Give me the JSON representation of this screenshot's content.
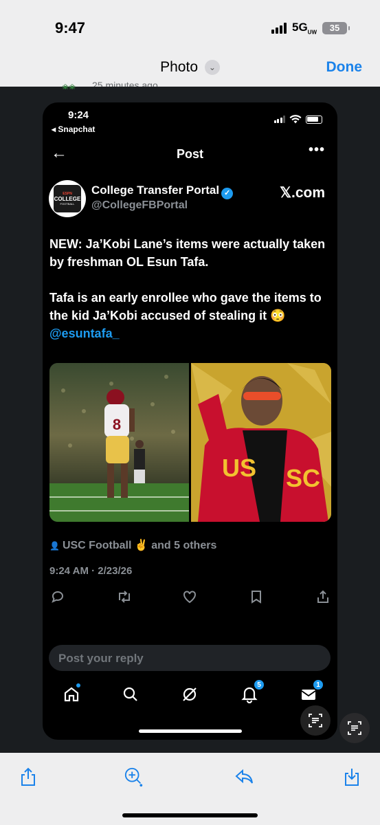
{
  "outer_status": {
    "time": "9:47",
    "network": "5G",
    "network_sub": "UW",
    "battery": "35"
  },
  "outer_nav": {
    "title": "Photo",
    "done_label": "Done"
  },
  "peek": {
    "text": "25 minutes ago"
  },
  "inner_status": {
    "time": "9:24",
    "back_app": "◂ Snapchat"
  },
  "post_header": {
    "back": "←",
    "title": "Post",
    "more": "•••"
  },
  "author": {
    "avatar_text_top": "ESPN",
    "avatar_text_mid": "COLLEGE",
    "avatar_text_bottom": "FOOTBALL",
    "name": "College Transfer Portal",
    "handle": "@CollegeFBPortal",
    "watermark": "𝕏.com"
  },
  "tweet": {
    "para1": "NEW: Ja’Kobi Lane’s items were actually taken by freshman OL Esun Tafa.",
    "para2_text": "Tafa is an early enrollee who gave the items to the kid Ja’Kobi accused of stealing it 😳 ",
    "mention": "@esuntafa_"
  },
  "images": {
    "left_jersey": "8",
    "right_jacket_left": "US",
    "right_jacket_right": "SC"
  },
  "likes": {
    "text": "USC Football ✌️ and 5 others"
  },
  "timestamp": "9:24 AM · 2/23/26",
  "actions": [
    "reply-icon",
    "repost-icon",
    "like-icon",
    "bookmark-icon",
    "share-icon"
  ],
  "reply_placeholder": "Post your reply",
  "bottom_nav": {
    "notifications_badge": "5",
    "messages_badge": "1"
  },
  "colors": {
    "accent": "#1d9bf0",
    "ios_blue": "#1a82ea",
    "usc_red": "#c8102e",
    "usc_gold": "#f2c230"
  }
}
